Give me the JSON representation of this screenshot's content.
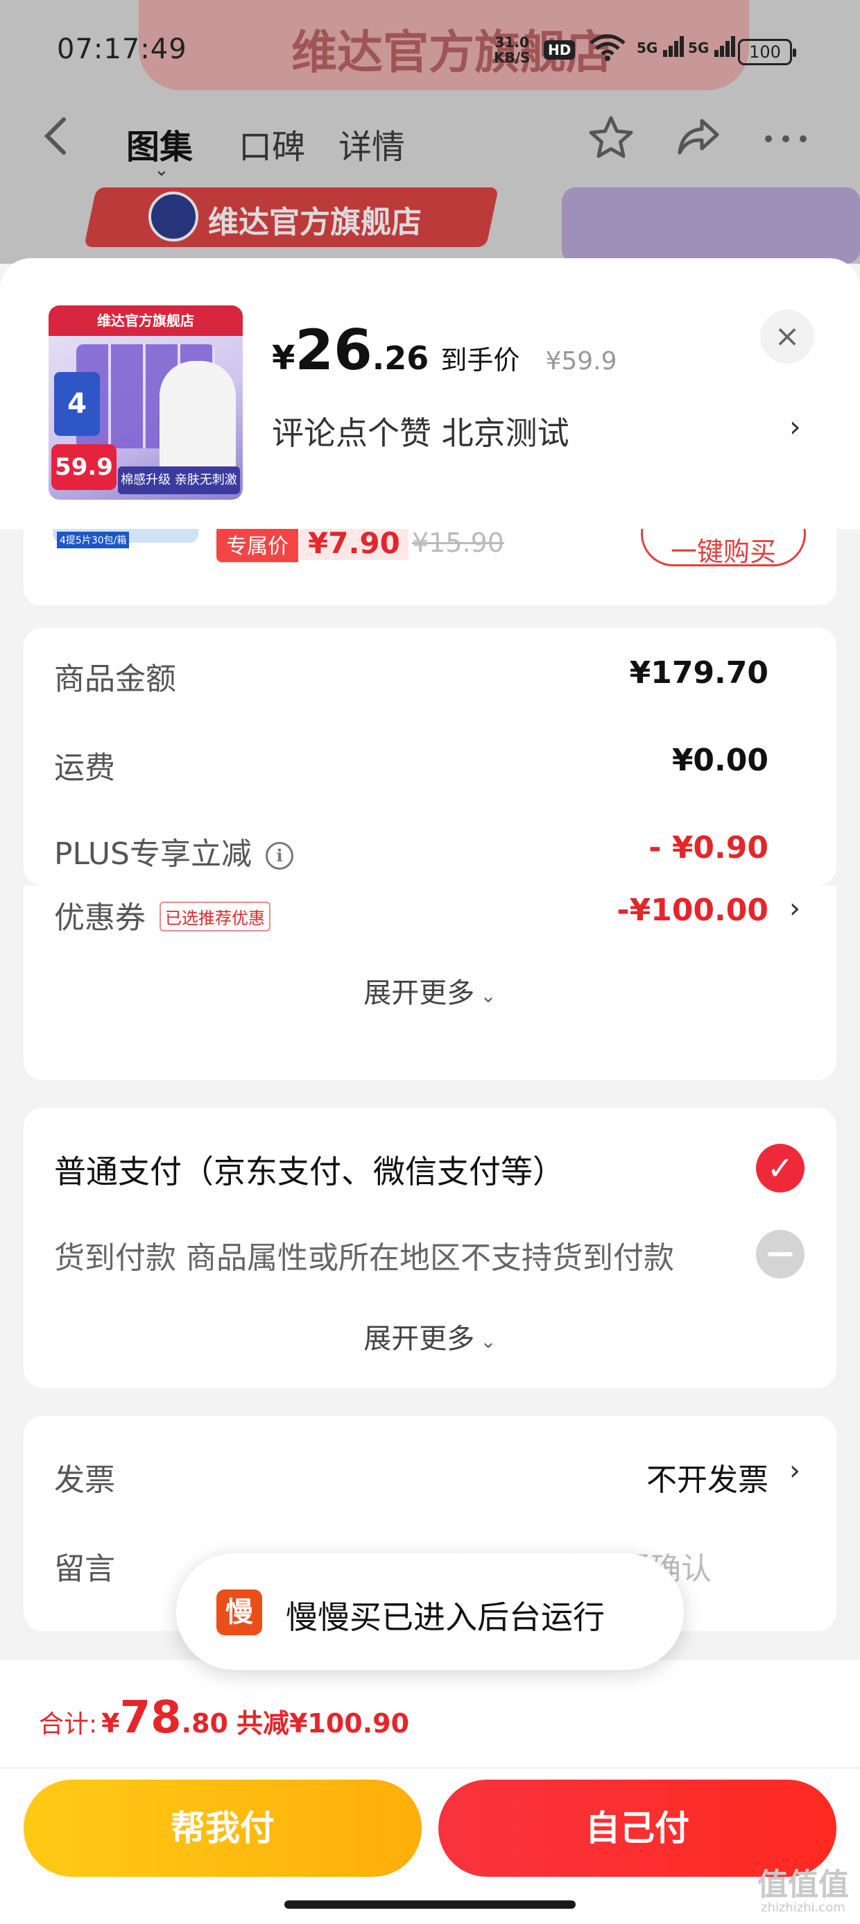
{
  "status_bar": {
    "time": "07:17:49",
    "net_speed_value": "31.0",
    "net_speed_unit": "KB/S",
    "hd": "HD",
    "signal_1": "5G",
    "signal_2": "5G",
    "battery": "100"
  },
  "background": {
    "banner_text": "维达官方旗舰店",
    "store_name": "维达官方旗舰店"
  },
  "nav": {
    "tabs": [
      "图集",
      "口碑",
      "详情"
    ]
  },
  "sheet": {
    "thumb": {
      "store": "维达官方旗舰店",
      "badge": "4",
      "price": "59.9",
      "slogan": "棉感升级 亲肤无刺激"
    },
    "price": {
      "currency": "¥",
      "integer": "26",
      "decimal": ".26",
      "tag": "到手价",
      "original": "¥59.9"
    },
    "comment": "评论点个赞  北京测试",
    "close_label": "×"
  },
  "rec_card": {
    "thumb_label": "4提5片30包/箱",
    "exclusive_tag": "专属价",
    "exclusive_price": "¥7.90",
    "original_price": "¥15.90",
    "buy_button": "一键购买"
  },
  "amounts": {
    "goods_label": "商品金额",
    "goods_value": "¥179.70",
    "shipping_label": "运费",
    "shipping_value": "¥0.00",
    "plus_label": "PLUS专享立减",
    "plus_value": "- ¥0.90",
    "coupon_label": "优惠券",
    "coupon_tag": "已选推荐优惠",
    "coupon_value": "-¥100.00",
    "expand": "展开更多"
  },
  "payment": {
    "normal": "普通支付（京东支付、微信支付等）",
    "cod": "货到付款 商品属性或所在地区不支持货到付款",
    "expand": "展开更多"
  },
  "invoice": {
    "label": "发票",
    "value": "不开发票",
    "message_label": "留言",
    "message_placeholder": "建议留言前先与商家沟通确认"
  },
  "toast": {
    "icon_text": "慢",
    "text": "慢慢买已进入后台运行"
  },
  "bottom": {
    "total_label": "合计:",
    "total_currency": "¥",
    "total_integer": "78",
    "total_decimal": ".80",
    "total_saving": "共减¥100.90",
    "friend_pay": "帮我付",
    "self_pay": "自己付"
  },
  "watermark": {
    "main": "值值值",
    "sub": "zhizhizhi.com"
  },
  "colors": {
    "accent_red": "#e4262b",
    "friend_button": "#ffbd12",
    "self_button": "#f8333e",
    "checked": "#ee2a3a"
  }
}
